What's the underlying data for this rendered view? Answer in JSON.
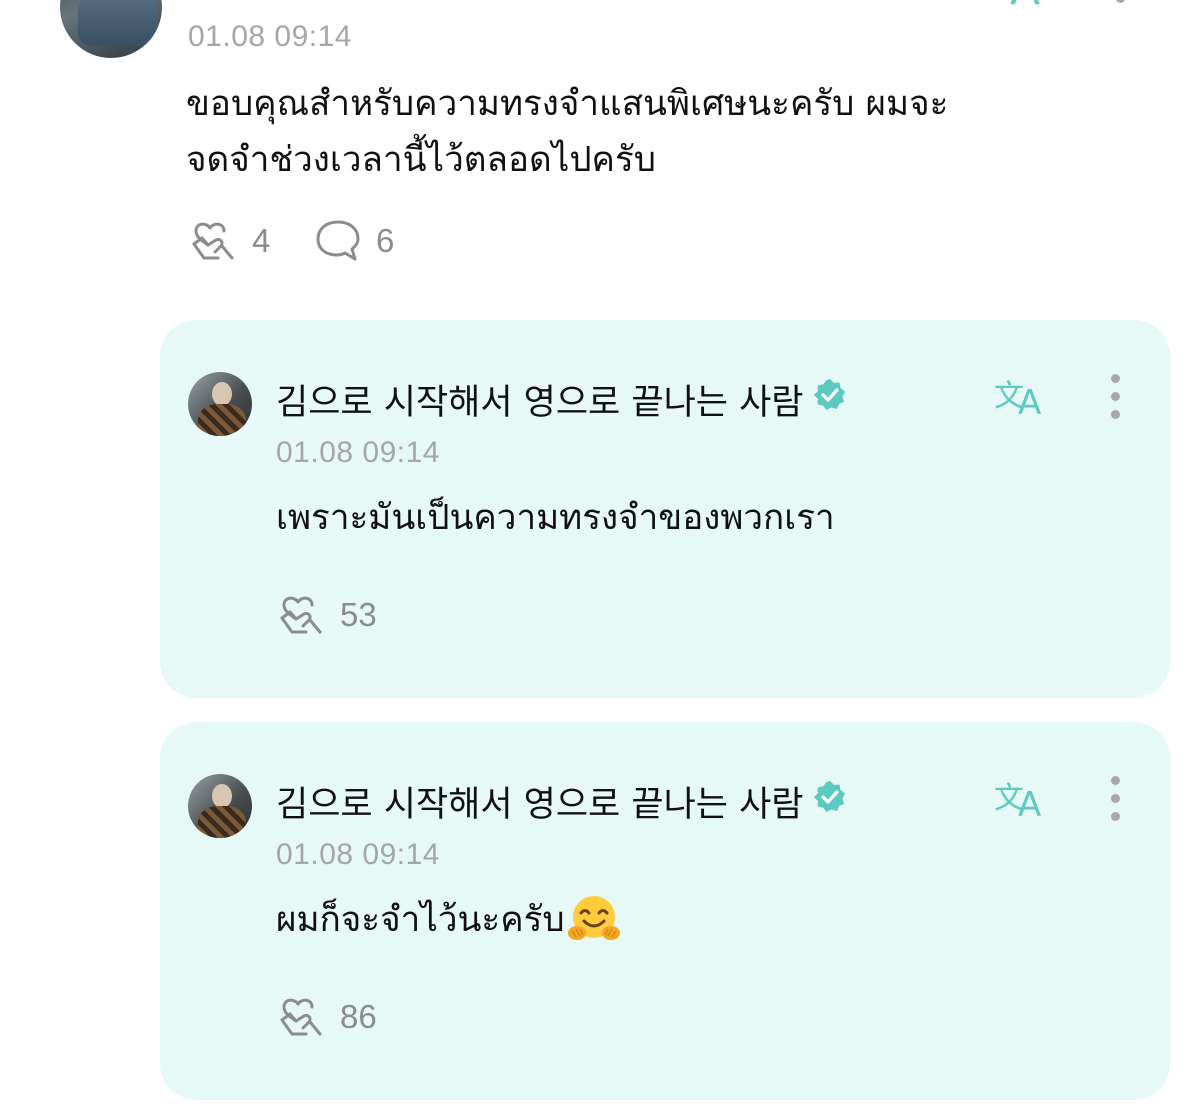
{
  "post": {
    "timestamp": "01.08 09:14",
    "text_line1": "ขอบคุณสำหรับความทรงจำแสนพิเศษนะครับ ผมจะ",
    "text_line2": "จดจำช่วงเวลานี้ไว้ตลอดไปครับ",
    "like_count": "4",
    "comment_count": "6"
  },
  "replies": [
    {
      "author": "김으로 시작해서 영으로 끝나는 사람",
      "timestamp": "01.08 09:14",
      "text": "เพราะมันเป็นความทรงจำของพวกเรา",
      "like_count": "53"
    },
    {
      "author": "김으로 시작해서 영으로 끝나는 사람",
      "timestamp": "01.08 09:14",
      "text": "ผมก็จะจำไว้นะครับ",
      "emoji_name": "hugging-face-emoji",
      "like_count": "86"
    }
  ],
  "colors": {
    "accent": "#5ccac0",
    "card_background": "#e6f9f6",
    "muted_text": "#a6a6a6",
    "icon_gray": "#8c8c8c"
  },
  "icons": {
    "like": "heart-hand-icon",
    "comment": "speech-bubble-icon",
    "translate": "translate-icon",
    "more": "more-vertical-icon",
    "verified": "verified-badge-icon"
  }
}
